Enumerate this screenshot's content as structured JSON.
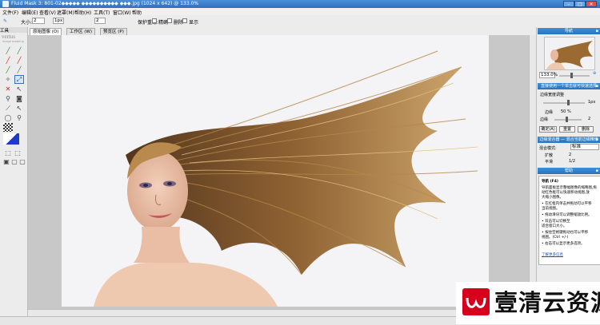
{
  "window": {
    "title": "Fluid Mask 3: 801-02◆◆◆◆◆ ◆◆◆◆◆◆◆◆◆◆ ◆◆◆.jpg (1024 x 642) @ 133.0%",
    "min_label": "–",
    "max_label": "□",
    "close_label": "✕"
  },
  "menubar": {
    "items": [
      "文件(F)",
      "编辑(E)",
      "查看(V)",
      "遮罩(M)",
      "帮助(H)",
      "工具(T)",
      "窗口(W)",
      "帮助"
    ]
  },
  "tool_options": {
    "size_label": "大小:",
    "size_value": "2",
    "value_a": "1px",
    "value_b": "2",
    "protect_label": "保护重缘:",
    "check1_label": "精确",
    "check2_label": "删除",
    "check3_label": "显示"
  },
  "toolbox": {
    "header": "工具",
    "logo": "vertus",
    "logo_sub": "image masking"
  },
  "tabs": [
    {
      "label": "原始图像 (O)"
    },
    {
      "label": "工作区 (W)"
    },
    {
      "label": "预览区 (P)"
    }
  ],
  "right_panel": {
    "preview_header": "导航",
    "zoom_value": "133.0%",
    "section2_header": "直接使用一个单击就可快速选择",
    "slider_label": "边缘宽度调整",
    "slider_value": "1px",
    "amount_label": "边缘",
    "amount_value": "50 %",
    "strength_label": "边缘",
    "strength_value": "2",
    "btn_apply": "确定(A)",
    "btn_reset": "重置",
    "btn_delete": "删除",
    "section3_header": "边缘混合器 — 混合当前边缘精修",
    "mode_label": "混合模式:",
    "mode_value": "标准",
    "dist_label": "扩散",
    "dist_value": "2",
    "smooth_label": "平滑",
    "smooth_value": "1/2",
    "help_header": "帮助",
    "help_lines": [
      "导航 (F4)",
      "导航面板显示整幅图像的缩略图,拖",
      "动红色框可以快速移动视图,放",
      "大缩小图像。",
      "• 在红框内单击并拖动可以平移",
      "  当前视图。",
      "• 拖动滑块可以调整缩放比例。",
      "• 双击可以切换至",
      "  适合窗口大小。",
      "• 按住空格键拖动也可以平移",
      "  视图。(Ctrl +/-)",
      "• 右击可以显示更多选项。",
      "",
      "了解更多信息"
    ]
  },
  "watermark": {
    "text": "壹清云资源"
  },
  "colors": {
    "accent": "#2a73bd",
    "hair_dark": "#5c3a1a",
    "hair_light": "#c9a063",
    "watermark_red": "#d6001c"
  }
}
